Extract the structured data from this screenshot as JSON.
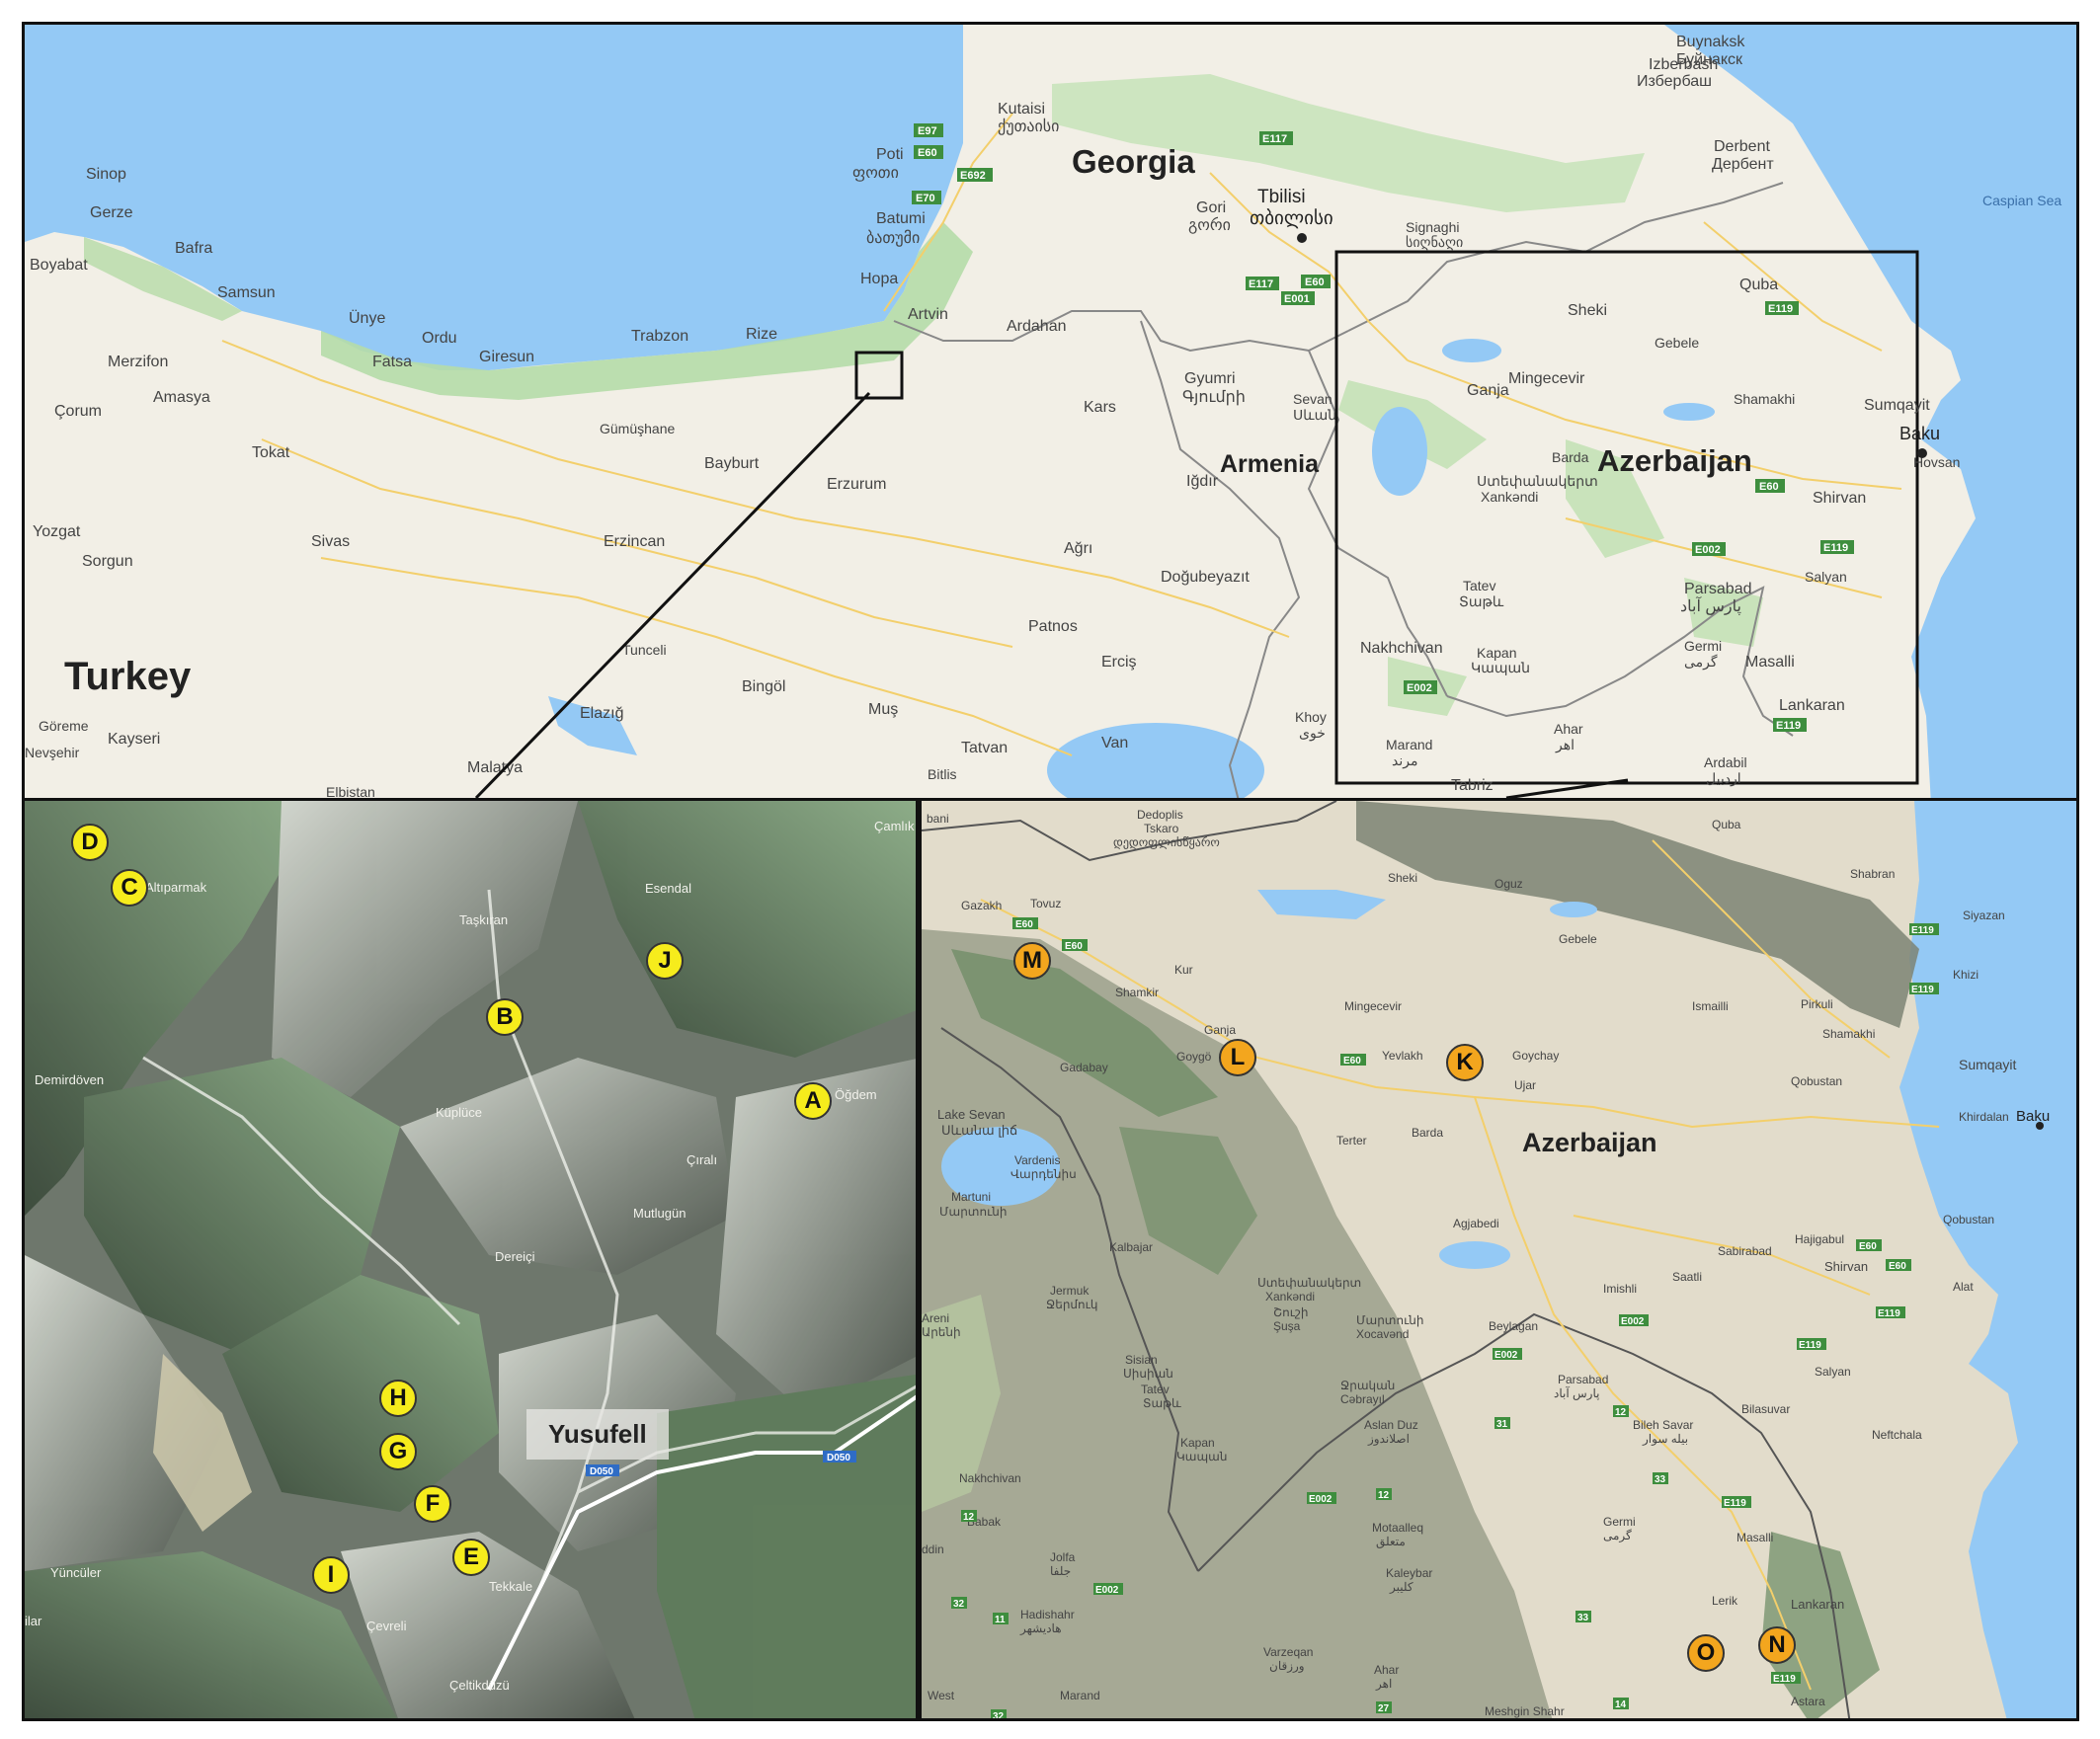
{
  "colors": {
    "sea": "#94c9f5",
    "land": "#f2efe6",
    "forest": "#b5dba8",
    "marker_yellow": "#f6ec1c",
    "marker_orange": "#f3a61e"
  },
  "top_map": {
    "countries": [
      "Georgia",
      "Turkey",
      "Armenia",
      "Azerbaijan"
    ],
    "sea": "Caspian Sea",
    "cities": {
      "buynaksk": "Buynaksk",
      "buynaksk_ru": "Буйнакск",
      "izberbash": "Izberbash",
      "izberbash_ru": "Избербаш",
      "kutaisi": "Kutaisi",
      "kutaisi_ka": "ქუთაისი",
      "derbent": "Derbent",
      "derbent_ru": "Дербент",
      "poti": "Poti",
      "poti_ka": "ფოთი",
      "tbilisi": "Tbilisi",
      "tbilisi_ka": "თბილისი",
      "gori": "Gori",
      "gori_ka": "გორი",
      "signaghi": "Signaghi",
      "signaghi_ka": "სიღნაღი",
      "sinop": "Sinop",
      "gerze": "Gerze",
      "batumi": "Batumi",
      "batumi_ka": "ბათუმი",
      "bafra": "Bafra",
      "boyabat": "Boyabat",
      "hopa": "Hopa",
      "quba": "Quba",
      "samsun": "Samsun",
      "artvin": "Artvin",
      "sheki": "Sheki",
      "unye": "Ünye",
      "ordu": "Ordu",
      "giresun": "Giresun",
      "trabzon": "Trabzon",
      "rize": "Rize",
      "ardahan": "Ardahan",
      "fatsa": "Fatsa",
      "gebele": "Gebele",
      "merzifon": "Merzifon",
      "amasya": "Amasya",
      "mingecevir": "Mingecevir",
      "ganja": "Ganja",
      "kars": "Kars",
      "gyumri": "Gyumri",
      "gyumri_hy": "Գյումրի",
      "sevan": "Sevan",
      "sevan_hy": "Սևան",
      "shamakhi": "Shamakhi",
      "sumqayit": "Sumqayit",
      "corum": "Çorum",
      "gumushane": "Gümüşhane",
      "baku": "Baku",
      "hovsan": "Hovsan",
      "tokat": "Tokat",
      "bayburt": "Bayburt",
      "barda": "Barda",
      "erzurum": "Erzurum",
      "igdir": "Iğdır",
      "stepanakert": "Ստեփանակերտ",
      "xankendi": "Xankəndi",
      "shirvan": "Shirvan",
      "yozgat": "Yozgat",
      "sivas": "Sivas",
      "erzincan": "Erzincan",
      "agri": "Ağrı",
      "sorgun": "Sorgun",
      "dogubeyazit": "Doğubeyazıt",
      "tatev": "Tatev",
      "tatev_hy": "Տաթև",
      "parsabad": "Parsabad",
      "parsabad_fa": "پارس آباد",
      "salyan": "Salyan",
      "patnos": "Patnos",
      "tunceli": "Tunceli",
      "nakhchivan": "Nakhchivan",
      "kapan": "Kapan",
      "kapan_hy": "Կապան",
      "germi": "Germi",
      "germi_fa": "گرمی",
      "ercis": "Erciş",
      "masalli": "Masalli",
      "bingol": "Bingöl",
      "goreme": "Göreme",
      "lankaran": "Lankaran",
      "kayseri": "Kayseri",
      "elazig": "Elazığ",
      "mus": "Muş",
      "khoy": "Khoy",
      "khoy_fa": "خوی",
      "van": "Van",
      "ahar": "Ahar",
      "ahar_fa": "اهر",
      "nevsehir": "Nevşehir",
      "marand": "Marand",
      "marand_fa": "مرند",
      "tatvan": "Tatvan",
      "malatya": "Malatya",
      "bitlis": "Bitlis",
      "elbistan": "Elbistan",
      "tabriz": "Tabriz",
      "ardabil": "Ardabil",
      "ardabil_fa": "اردبیل"
    },
    "roads": {
      "e97": "E97",
      "e60": "E60",
      "e692": "E692",
      "e70": "E70",
      "e117": "E117",
      "e001": "E001",
      "e119": "E119",
      "e002": "E002"
    }
  },
  "yusufeli_map": {
    "tag": "Yusufell",
    "places": {
      "camlik": "Çamlık",
      "altiparmak": "Altıparmak",
      "esendal": "Esendal",
      "taskiran": "Taşkıran",
      "demirdoven": "Demirdöven",
      "kupluce": "Küplüce",
      "ogdem": "Öğdem",
      "cirali": "Çıralı",
      "mutlugun": "Mutlugün",
      "dereici": "Dereiçi",
      "tekkale": "Tekkale",
      "yunculer": "Yüncüler",
      "cevreli": "Çevreli",
      "celtikduzu": "Çeltikdüzü",
      "ilar": "ilar"
    },
    "roads": {
      "d050": "D050"
    },
    "markers": [
      "A",
      "B",
      "C",
      "D",
      "E",
      "F",
      "G",
      "H",
      "I",
      "J"
    ]
  },
  "azerbaijan_map": {
    "country": "Azerbaijan",
    "places": {
      "dedoplis": "Dedoplis",
      "tskaro": "Tskaro",
      "dedoplis_ka": "დედოფლისწყარო",
      "quba": "Quba",
      "sheki": "Sheki",
      "qusar": "Oguz",
      "shabran": "Shabran",
      "bani": "bani",
      "gazakh": "Gazakh",
      "tovuz": "Tovuz",
      "siyazan": "Siyazan",
      "gebele": "Gebele",
      "kur": "Kur",
      "khizi": "Khizi",
      "shamkir": "Shamkir",
      "mingecevir": "Mingecevir",
      "ismailli": "Ismailli",
      "pirkuli": "Pirkuli",
      "ganja": "Ganja",
      "goygol": "Goygö",
      "yevlakh": "Yevlakh",
      "goychay": "Goychay",
      "shamakhi": "Shamakhi",
      "gadabay": "Gadabay",
      "ujar": "Ujar",
      "qobustan": "Qobustan",
      "sumqayit": "Sumqayit",
      "lake_sevan": "Lake Sevan",
      "lake_sevan_hy": "Սևանա լիճ",
      "terter": "Terter",
      "barda": "Barda",
      "khirdalan": "Khirdalan",
      "baku": "Baku",
      "vardenis": "Vardenis",
      "vardenis_hy": "Վարդենիս",
      "martuni": "Martuni",
      "martuni_hy": "Մարտունի",
      "aghjabadi": "Agjabedi",
      "qobustan2": "Qobustan",
      "kalbajar": "Kalbajar",
      "hajigabul": "Hajigabul",
      "sabirabad": "Sabirabad",
      "shirvan": "Shirvan",
      "saatli": "Saatli",
      "alat": "Alat",
      "jermuk": "Jermuk",
      "jermuk_hy": "Ջերմուկ",
      "stepanakert": "Ստեփանակերտ",
      "xankendi": "Xankəndi",
      "imishli": "Imishli",
      "areni": "Areni",
      "areni_hy": "Արենի",
      "shusha": "Շուշի",
      "susa": "Şuşa",
      "martakert": "Մարտունի",
      "xocavend": "Xocavənd",
      "beylagan": "Beylagan",
      "sisian": "Sisian",
      "sisian_hy": "Սիսիան",
      "jabrayil": "Ջրական",
      "cebrayil": "Cəbrayıl",
      "parsabad": "Parsabad",
      "parsabad_fa": "پارس آباد",
      "salyan": "Salyan",
      "tatev": "Tatev",
      "tatev_hy": "Տաթև",
      "bilasuvar": "Bilasuvar",
      "aslan_duz": "Aslan Duz",
      "aslan_duz_fa": "اصلاندوز",
      "bileh_savar": "Bileh Savar",
      "bileh_savar_fa": "بیله سوار",
      "neftchala": "Neftchala",
      "kapan": "Kapan",
      "kapan_hy": "Կապան",
      "nakhchivan": "Nakhchivan",
      "babak": "Babak",
      "germi": "Germi",
      "germi_fa": "گرمی",
      "masalli": "Masalli",
      "motaalleq": "Motaalleq",
      "motaalleq_fa": "متعلق",
      "sadarak": "ddin",
      "jolfa": "Jolfa",
      "jolfa_fa": "جلفا",
      "kaleybar": "Kaleybar",
      "kaleybar_fa": "کلیبر",
      "lerik": "Lerik",
      "lankaran": "Lankaran",
      "hadishahr": "Hadishahr",
      "hadishahr_fa": "هادیشهر",
      "varzeqan": "Varzeqan",
      "varzeqan_fa": "ورزقان",
      "ahar": "Ahar",
      "ahar_fa": "اهر",
      "west": "West",
      "marand": "Marand",
      "meshgin": "Meshgin Shahr",
      "astara": "Astara"
    },
    "roads": {
      "e60": "E60",
      "e119": "E119",
      "e002": "E002",
      "r12": "12",
      "r31": "31",
      "r33": "33",
      "r32": "32",
      "r11": "11",
      "r27": "27",
      "r14": "14"
    },
    "markers": [
      "K",
      "L",
      "M",
      "N",
      "O"
    ]
  }
}
